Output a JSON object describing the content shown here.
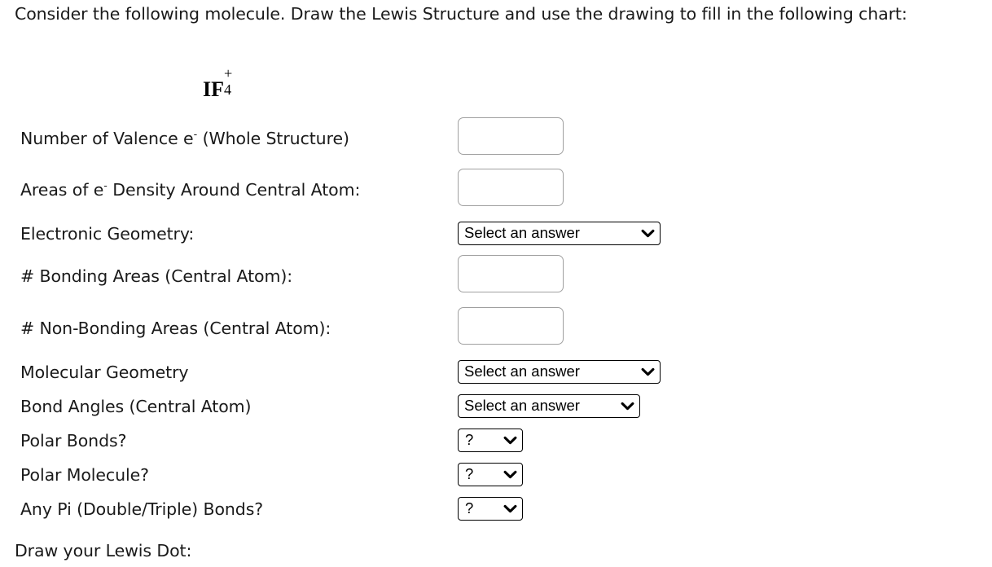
{
  "intro": {
    "text": "Consider the following molecule.  Draw the Lewis Structure and use the drawing to fill in the following chart:"
  },
  "formula": {
    "base": "IF",
    "superscript": "+",
    "subscript": "4",
    "plain": "IF4+"
  },
  "rows": [
    {
      "id": "valence-electrons",
      "label_pre": "Number of Valence e",
      "label_sup": "-",
      "label_post": " (Whole Structure)",
      "control": "text",
      "value": "",
      "placeholder": ""
    },
    {
      "id": "areas-of-density",
      "label_pre": "Areas of e",
      "label_sup": "-",
      "label_post": " Density Around Central Atom:",
      "control": "text",
      "value": "",
      "placeholder": ""
    },
    {
      "id": "electronic-geometry",
      "label_pre": "Electronic Geometry:",
      "label_sup": "",
      "label_post": "",
      "control": "select",
      "value": "Select an answer"
    },
    {
      "id": "bonding-areas",
      "label_pre": "# Bonding Areas (Central Atom):",
      "label_sup": "",
      "label_post": "",
      "control": "text",
      "value": "",
      "placeholder": ""
    },
    {
      "id": "non-bonding-areas",
      "label_pre": "# Non-Bonding Areas (Central Atom):",
      "label_sup": "",
      "label_post": "",
      "control": "text",
      "value": "",
      "placeholder": ""
    },
    {
      "id": "molecular-geometry",
      "label_pre": "Molecular Geometry",
      "label_sup": "",
      "label_post": "",
      "control": "select",
      "value": "Select an answer"
    },
    {
      "id": "bond-angles",
      "label_pre": "Bond Angles (Central Atom)",
      "label_sup": "",
      "label_post": "",
      "control": "select",
      "value": "Select an answer"
    },
    {
      "id": "polar-bonds",
      "label_pre": "Polar Bonds?",
      "label_sup": "",
      "label_post": "",
      "control": "select",
      "value": "?"
    },
    {
      "id": "polar-molecule",
      "label_pre": "Polar Molecule?",
      "label_sup": "",
      "label_post": "",
      "control": "select",
      "value": "?"
    },
    {
      "id": "pi-bonds",
      "label_pre": "Any Pi (Double/Triple) Bonds?",
      "label_sup": "",
      "label_post": "",
      "control": "select",
      "value": "?"
    }
  ],
  "footer": {
    "label": "Draw your Lewis Dot:"
  },
  "icons": {
    "chevron": "chevron-down-icon"
  },
  "colors": {
    "text": "#1a1a1a",
    "input_border": "#a0a0a0",
    "select_border": "#000000",
    "background": "#ffffff"
  }
}
